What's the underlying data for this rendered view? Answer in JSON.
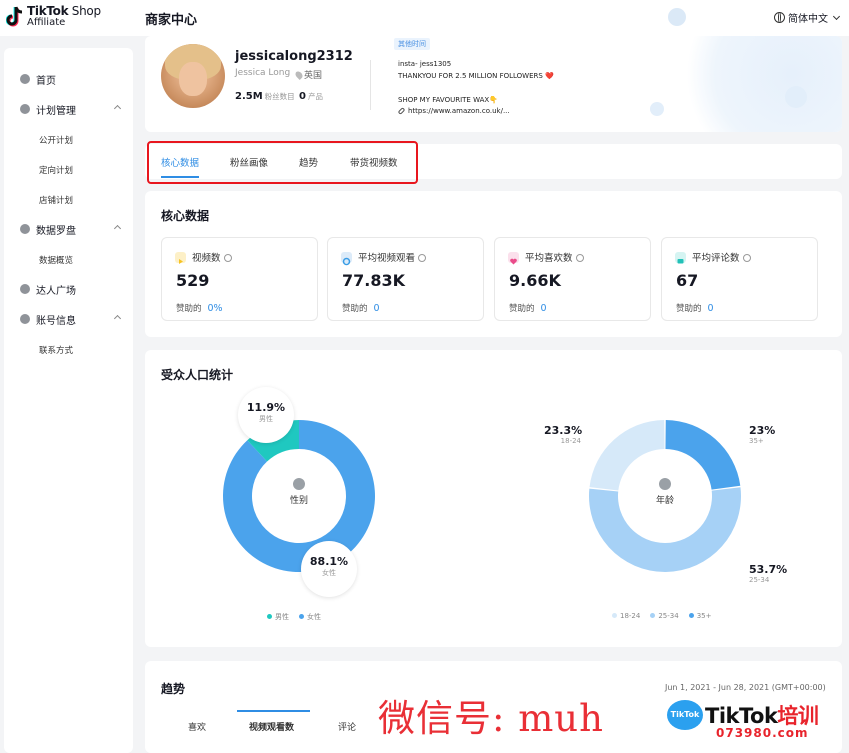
{
  "app": {
    "logo_line1": "TikTok",
    "logo_line1_suffix": " Shop",
    "logo_line2": "Affiliate",
    "page_title": "商家中心",
    "language": "简体中文"
  },
  "sidebar": {
    "items": [
      {
        "label": "首页",
        "icon": "home-icon"
      },
      {
        "label": "计划管理",
        "icon": "plan-icon"
      },
      {
        "label": "公开计划"
      },
      {
        "label": "定向计划"
      },
      {
        "label": "店铺计划"
      },
      {
        "label": "数据罗盘",
        "icon": "compass-icon"
      },
      {
        "label": "数据概览"
      },
      {
        "label": "达人广场",
        "icon": "creator-icon"
      },
      {
        "label": "账号信息",
        "icon": "account-icon"
      },
      {
        "label": "联系方式"
      }
    ]
  },
  "profile": {
    "username": "jessicalong2312",
    "display_name": "Jessica Long",
    "location": "英国",
    "followers_value": "2.5M",
    "followers_label": "粉丝数目",
    "products_value": "0",
    "products_label": "产品",
    "other_tag": "其他时间",
    "bio": "insta- jess1305\nTHANKYOU FOR 2.5 MILLION FOLLOWERS ❤️\n\nSHOP MY FAVOURITE WAX👇",
    "link": "https://www.amazon.co.uk/..."
  },
  "tabs": [
    "核心数据",
    "粉丝画像",
    "趋势",
    "带货视频数"
  ],
  "core": {
    "title": "核心数据",
    "metrics": [
      {
        "label": "视频数",
        "value": "529",
        "foot": "赞助的",
        "foot_value": "0%",
        "color": "#f7c324"
      },
      {
        "label": "平均视频观看",
        "value": "77.83K",
        "foot": "赞助的",
        "foot_value": "0",
        "color": "#3a9de6"
      },
      {
        "label": "平均喜欢数",
        "value": "9.66K",
        "foot": "赞助的",
        "foot_value": "0",
        "color": "#ea4c8a"
      },
      {
        "label": "平均评论数",
        "value": "67",
        "foot": "赞助的",
        "foot_value": "0",
        "color": "#22c1b8"
      }
    ]
  },
  "demographics": {
    "title": "受众人口统计",
    "gender": {
      "center_label": "性别",
      "male_pct": "11.9%",
      "male_label": "男性",
      "female_pct": "88.1%",
      "female_label": "女性",
      "male_share": 0.119,
      "legend": [
        "男性",
        "女性"
      ],
      "colors": [
        "#1fc8c0",
        "#4ba3ec"
      ]
    },
    "age": {
      "center_label": "年龄",
      "segments": [
        {
          "label": "18-24",
          "pct": "23.3%",
          "share": 0.233,
          "color": "#d6e9f9"
        },
        {
          "label": "25-34",
          "pct": "53.7%",
          "share": 0.537,
          "color": "#a6d1f6"
        },
        {
          "label": "35+",
          "pct": "23%",
          "share": 0.23,
          "color": "#4ba3ec"
        }
      ]
    }
  },
  "trend": {
    "title": "趋势",
    "date_range": "Jun 1, 2021 - Jun 28, 2021 (GMT+00:00)",
    "tabs": [
      "喜欢",
      "视频观看数",
      "评论"
    ]
  },
  "watermark": {
    "text": "微信号: muh",
    "logo_badge": "TikTok",
    "logo_text": "TikTok",
    "logo_suffix": "培训",
    "sub": "073980.com"
  }
}
